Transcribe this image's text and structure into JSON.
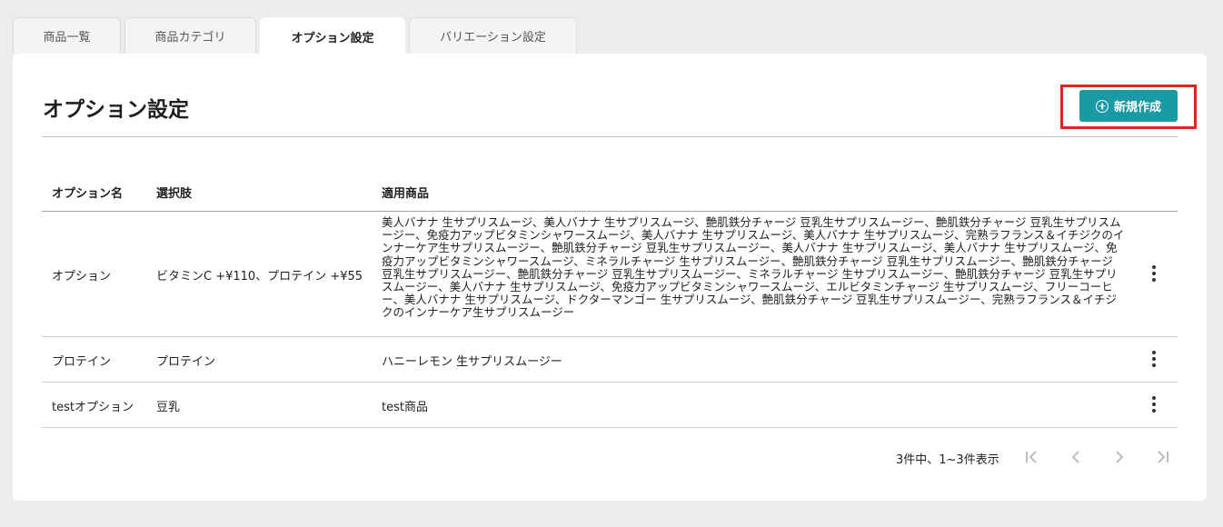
{
  "tabs": [
    {
      "label": "商品一覧"
    },
    {
      "label": "商品カテゴリ"
    },
    {
      "label": "オプション設定"
    },
    {
      "label": "バリエーション設定"
    }
  ],
  "page": {
    "title": "オプション設定"
  },
  "new_button": {
    "label": "新規作成",
    "icon": "plus-circle-icon",
    "color": "#1a9aa4"
  },
  "highlight_color": "#e02424",
  "table": {
    "headers": {
      "name": "オプション名",
      "choices": "選択肢",
      "products": "適用商品"
    },
    "rows": [
      {
        "name": "オプション",
        "choices": "ビタミンC +¥110、プロテイン +¥55",
        "products": "美人バナナ 生サプリスムージ、美人バナナ 生サプリスムージ、艶肌鉄分チャージ 豆乳生サプリスムージー、艶肌鉄分チャージ 豆乳生サプリスムージー、免疫力アップビタミンシャワースムージ、美人バナナ 生サプリスムージ、美人バナナ 生サプリスムージ、完熟ラフランス＆イチジクのインナーケア生サプリスムージー、艶肌鉄分チャージ 豆乳生サプリスムージー、美人バナナ 生サプリスムージ、美人バナナ 生サプリスムージ、免疫力アップビタミンシャワースムージ、ミネラルチャージ 生サプリスムージー、艶肌鉄分チャージ 豆乳生サプリスムージー、艶肌鉄分チャージ 豆乳生サプリスムージー、艶肌鉄分チャージ 豆乳生サプリスムージー、ミネラルチャージ 生サプリスムージー、艶肌鉄分チャージ 豆乳生サプリスムージー、美人バナナ 生サプリスムージ、免疫力アップビタミンシャワースムージ、エルビタミンチャージ 生サプリスムージ、フリーコーヒー、美人バナナ 生サプリスムージ、ドクターマンゴー 生サプリスムージ、艶肌鉄分チャージ 豆乳生サプリスムージー、完熟ラフランス＆イチジクのインナーケア生サプリスムージー"
      },
      {
        "name": "プロテイン",
        "choices": "プロテイン",
        "products": "ハニーレモン 生サプリスムージー"
      },
      {
        "name": "testオプション",
        "choices": "豆乳",
        "products": "test商品"
      }
    ]
  },
  "pagination": {
    "info": "3件中、1~3件表示",
    "buttons": [
      "first-page-icon",
      "prev-page-icon",
      "next-page-icon",
      "last-page-icon"
    ]
  }
}
